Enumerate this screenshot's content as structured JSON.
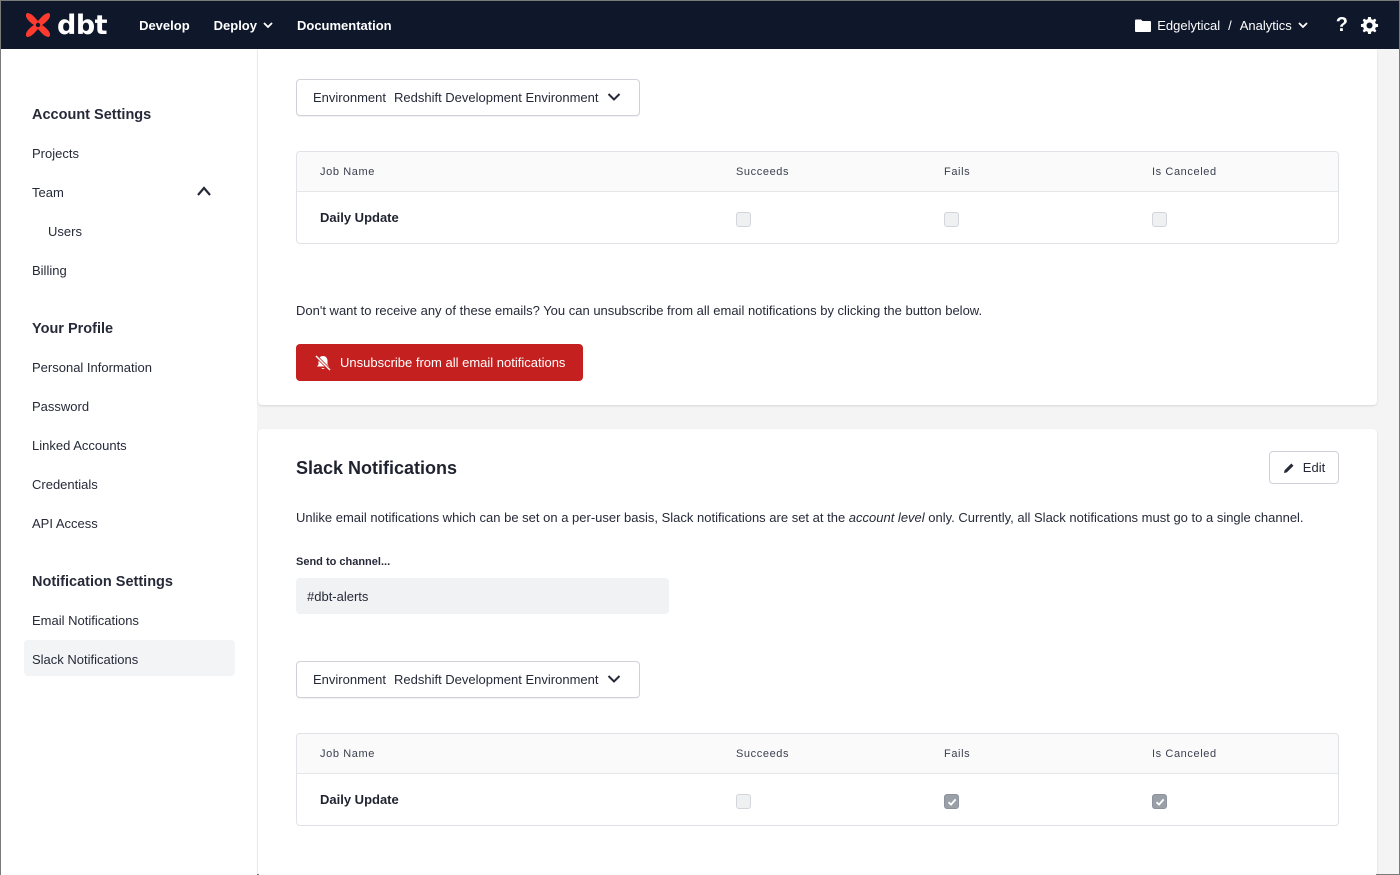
{
  "topbar": {
    "logo_text": "dbt",
    "nav": [
      "Develop",
      "Deploy",
      "Documentation"
    ],
    "account": "Edgelytical",
    "separator": "/",
    "project": "Analytics",
    "help": "?"
  },
  "sidebar": {
    "sections": [
      {
        "title": "Account Settings",
        "items": [
          "Projects",
          "Team",
          "Users",
          "Billing"
        ]
      },
      {
        "title": "Your Profile",
        "items": [
          "Personal Information",
          "Password",
          "Linked Accounts",
          "Credentials",
          "API Access"
        ]
      },
      {
        "title": "Notification Settings",
        "items": [
          "Email Notifications",
          "Slack Notifications"
        ]
      }
    ],
    "active": "Slack Notifications"
  },
  "email": {
    "environment_label": "Environment",
    "environment_value": "Redshift Development Environment",
    "table_headers": [
      "Job Name",
      "Succeeds",
      "Fails",
      "Is Canceled"
    ],
    "rows": [
      {
        "job": "Daily Update",
        "succeeds": false,
        "fails": false,
        "canceled": false
      }
    ],
    "note": "Don't want to receive any of these emails? You can unsubscribe from all email notifications by clicking the button below.",
    "unsubscribe_label": "Unsubscribe from all email notifications"
  },
  "slack": {
    "title": "Slack Notifications",
    "edit_label": "Edit",
    "desc_before": "Unlike email notifications which can be set on a per-user basis, Slack notifications are set at the ",
    "desc_em": "account level",
    "desc_after": " only. Currently, all Slack notifications must go to a single channel.",
    "channel_label": "Send to channel...",
    "channel_value": "#dbt-alerts",
    "environment_label": "Environment",
    "environment_value": "Redshift Development Environment",
    "table_headers": [
      "Job Name",
      "Succeeds",
      "Fails",
      "Is Canceled"
    ],
    "rows": [
      {
        "job": "Daily Update",
        "succeeds": false,
        "fails": true,
        "canceled": true
      }
    ]
  },
  "colors": {
    "topbar": "#0f172a",
    "danger": "#c3201f",
    "brand": "#ff694b"
  }
}
